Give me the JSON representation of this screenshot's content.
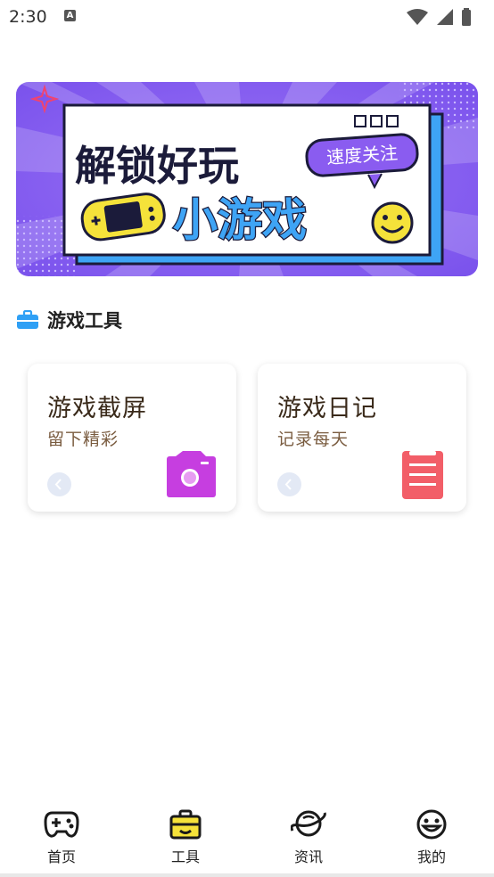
{
  "status_bar": {
    "time": "2:30",
    "notification_letter": "A"
  },
  "banner": {
    "headline_line1": "解锁好玩",
    "headline_line2": "小游戏",
    "tag": "速度关注"
  },
  "section": {
    "title": "游戏工具"
  },
  "cards": [
    {
      "title": "游戏截屏",
      "subtitle": "留下精彩",
      "icon": "camera-icon",
      "icon_color": "#c63ee0"
    },
    {
      "title": "游戏日记",
      "subtitle": "记录每天",
      "icon": "notepad-icon",
      "icon_color": "#f25e68"
    }
  ],
  "bottom_nav": {
    "active_index": 1,
    "items": [
      {
        "label": "首页",
        "icon": "gamepad-icon"
      },
      {
        "label": "工具",
        "icon": "toolbox-icon"
      },
      {
        "label": "资讯",
        "icon": "planet-icon"
      },
      {
        "label": "我的",
        "icon": "smiley-icon"
      }
    ]
  },
  "colors": {
    "banner_purple": "#8a5cf0",
    "banner_blue": "#3ea4f5",
    "accent_yellow": "#f5e23a",
    "section_icon": "#2fa0f5"
  }
}
